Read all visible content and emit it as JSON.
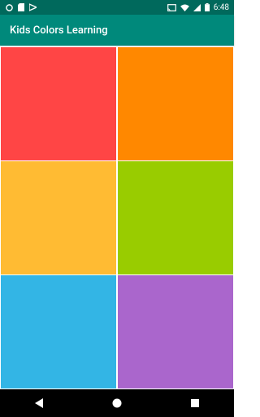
{
  "status_bar": {
    "time": "6:48",
    "icons": [
      "notification-dot-icon",
      "sd-card-icon",
      "download-icon",
      "cast-icon",
      "wifi-icon",
      "signal-icon",
      "battery-icon"
    ]
  },
  "app_bar": {
    "title": "Kids Colors Learning"
  },
  "color_grid": {
    "tiles": [
      {
        "name": "red-tile",
        "color": "#ff4545"
      },
      {
        "name": "orange-tile",
        "color": "#ff8800"
      },
      {
        "name": "yellow-tile",
        "color": "#ffbb33"
      },
      {
        "name": "green-tile",
        "color": "#99cc00"
      },
      {
        "name": "blue-tile",
        "color": "#33b5e5"
      },
      {
        "name": "purple-tile",
        "color": "#aa66cc"
      }
    ]
  },
  "nav_bar": {
    "buttons": [
      "back-icon",
      "home-icon",
      "recents-icon"
    ]
  }
}
